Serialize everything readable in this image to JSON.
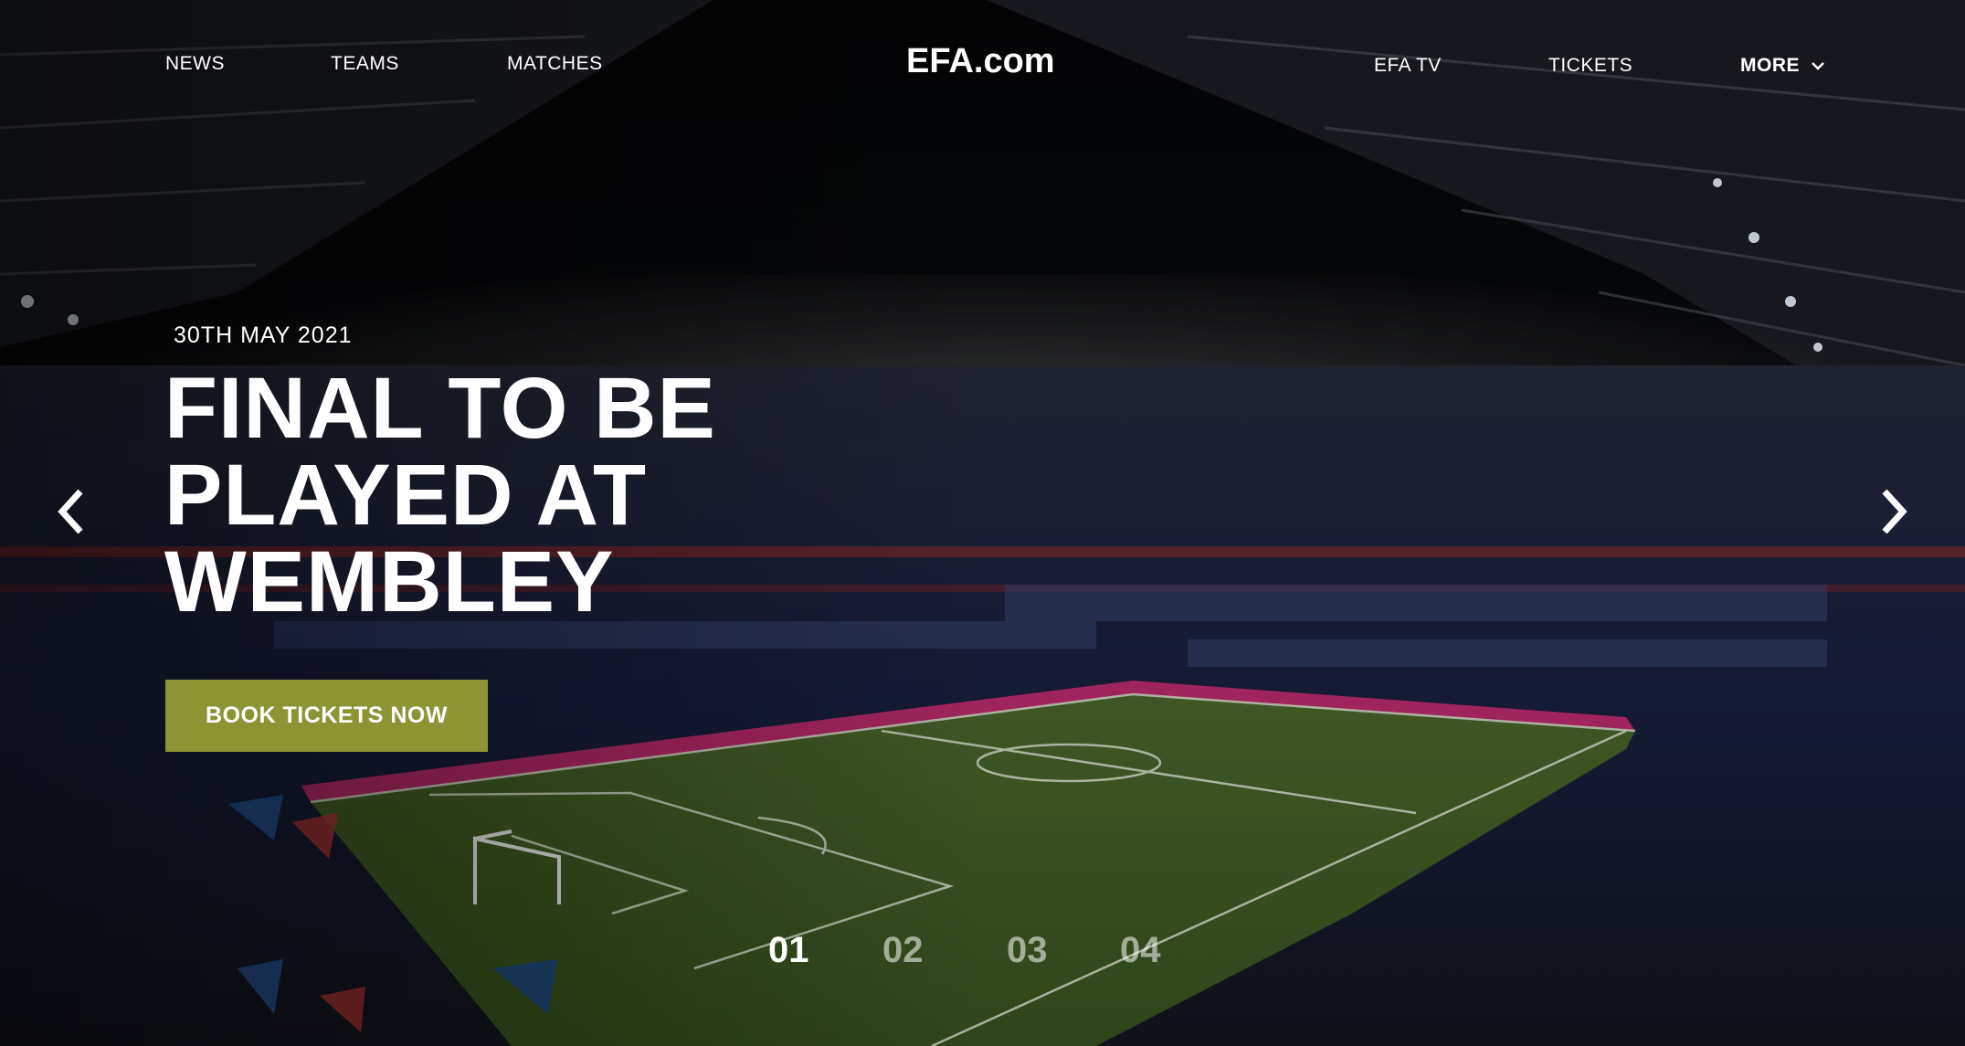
{
  "nav": {
    "news": "NEWS",
    "teams": "TEAMS",
    "matches": "MATCHES",
    "brand": "EFA.com",
    "efa_tv": "EFA TV",
    "tickets": "TICKETS",
    "more": "MORE",
    "more_icon": "chevron-down-icon"
  },
  "hero": {
    "date": "30TH MAY 2021",
    "headline_lines": [
      "FINAL TO BE",
      "PLAYED AT",
      "WEMBLEY"
    ],
    "cta_label": "BOOK TICKETS NOW",
    "cta_color": "#8c9433",
    "prev_icon": "chevron-left-icon",
    "next_icon": "chevron-right-icon"
  },
  "pagination": {
    "items": [
      "01",
      "02",
      "03",
      "04"
    ],
    "active": "01"
  }
}
